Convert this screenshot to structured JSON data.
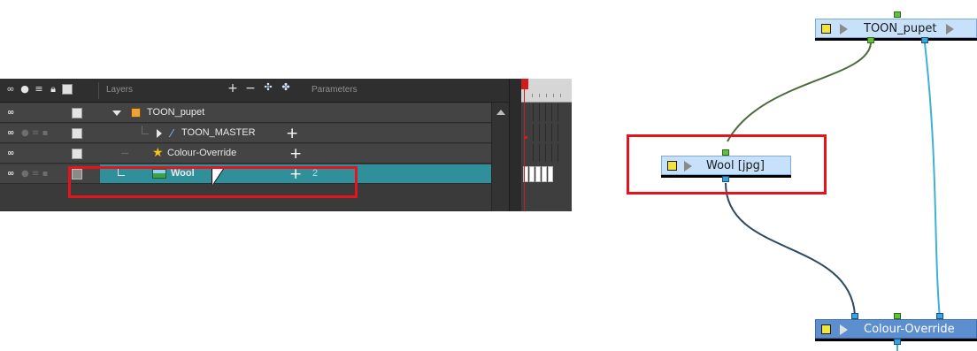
{
  "timeline": {
    "header": {
      "layers_label": "Layers",
      "parameters_label": "Parameters",
      "column_icons": [
        "onion-skin-icon",
        "visibility-icon",
        "stack-icon",
        "lock-icon",
        "color-swatch-icon"
      ],
      "tool_icons": [
        "add-layer-icon",
        "remove-layer-icon",
        "add-peg-icon",
        "add-sub-icon"
      ]
    },
    "layers": [
      {
        "name": "TOON_pupet",
        "icon": "group-folder-icon",
        "expanded": true
      },
      {
        "name": "TOON_MASTER",
        "icon": "peg-icon",
        "expanded": false
      },
      {
        "name": "Colour-Override",
        "icon": "star-icon"
      },
      {
        "name": "Wool",
        "icon": "image-icon",
        "selected": true,
        "value": "2"
      }
    ]
  },
  "nodes": {
    "toon_pupet": {
      "label": "TOON_pupet"
    },
    "wool": {
      "label": "Wool [jpg]"
    },
    "colour_override": {
      "label": "Colour-Override"
    }
  },
  "colors": {
    "highlight": "#e3141c",
    "selected_row": "#2f8f9b",
    "wire_green": "#4c6b3b",
    "wire_cyan": "#3fb0d6",
    "wire_dark": "#2e4a5c"
  }
}
